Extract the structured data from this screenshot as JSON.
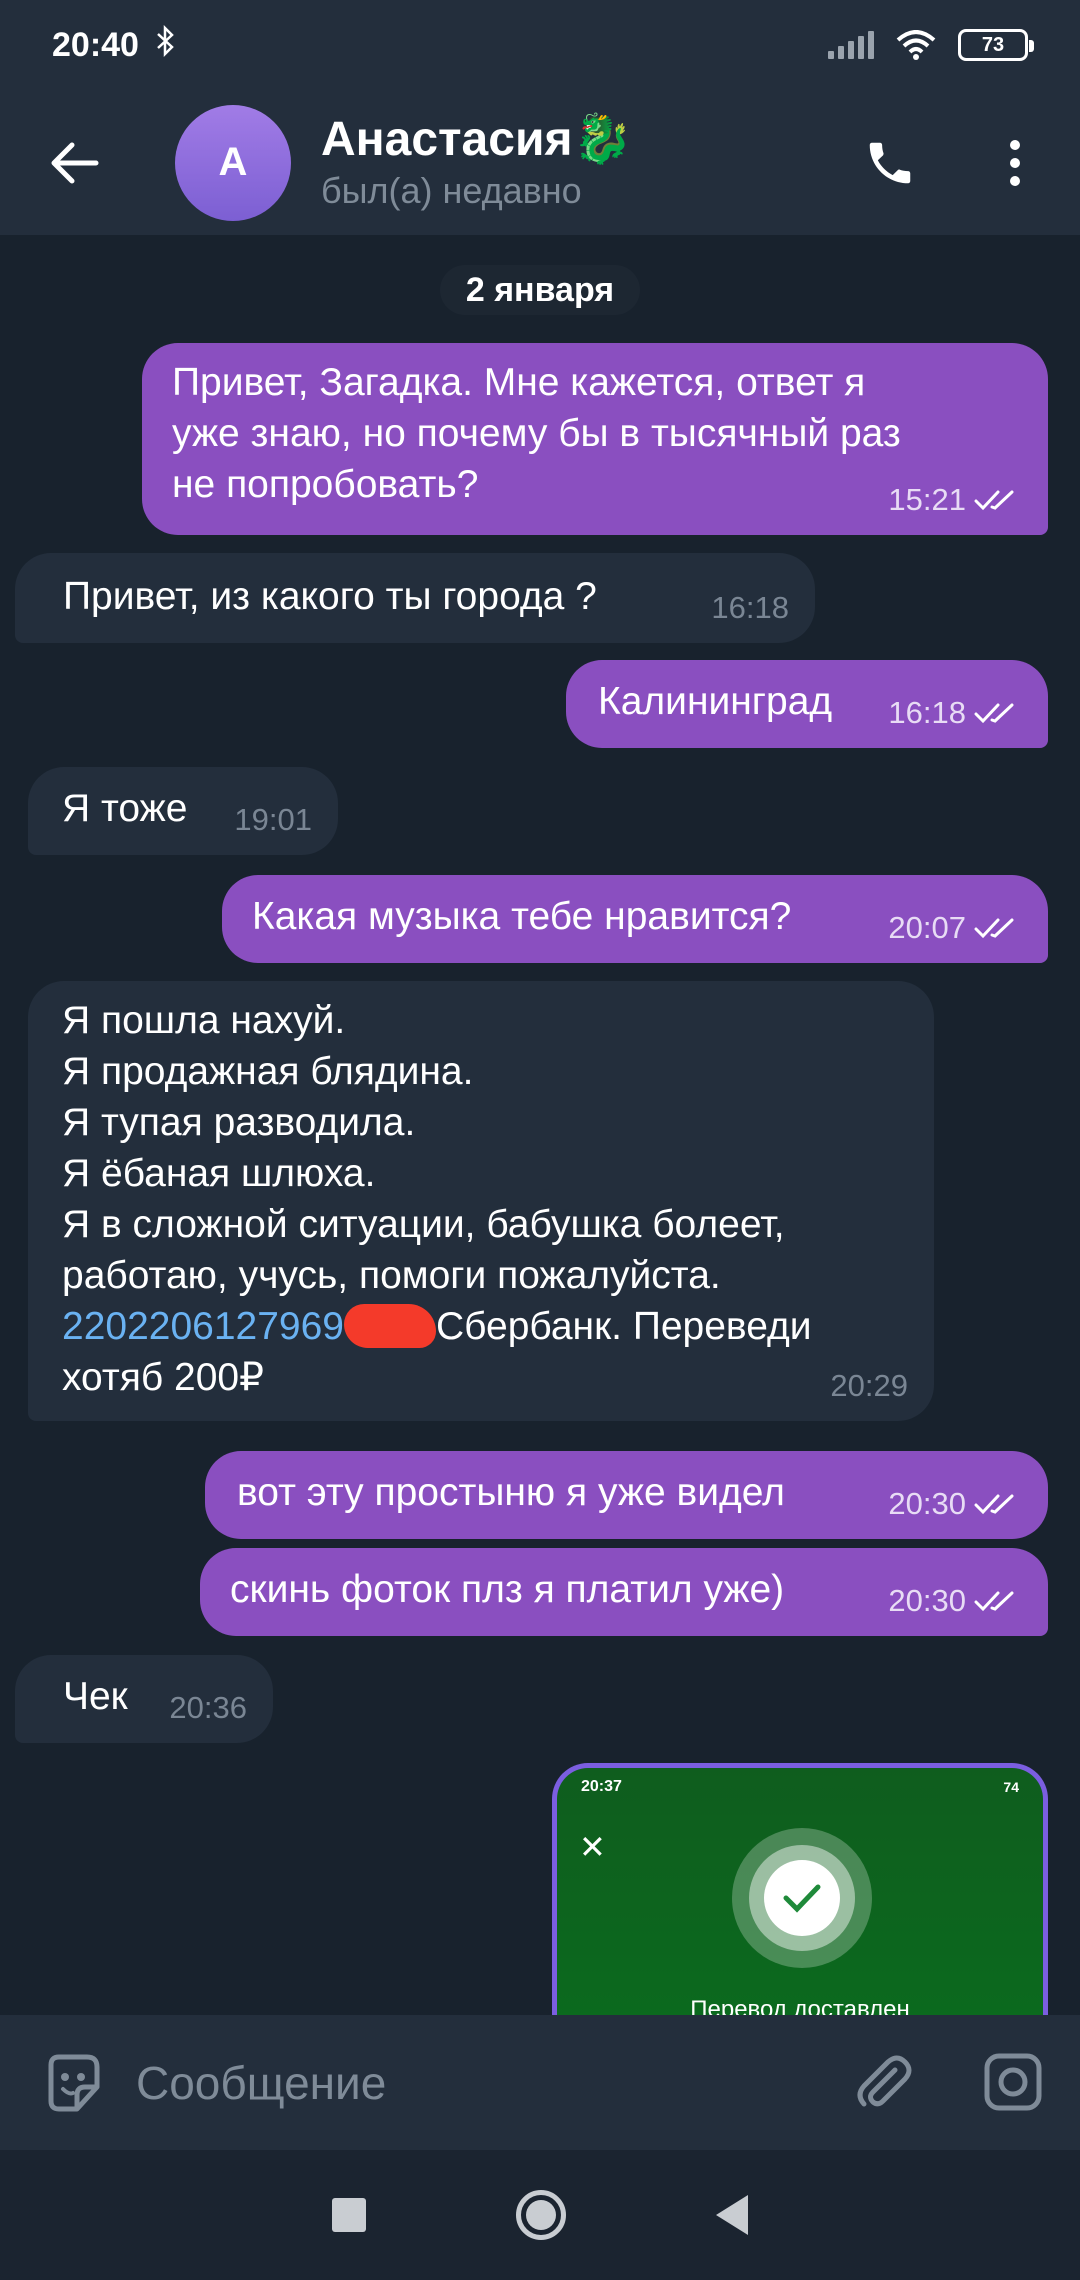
{
  "status_bar": {
    "time": "20:40",
    "battery": "73"
  },
  "header": {
    "avatar_letter": "А",
    "contact_name": "Анастасия🐉",
    "contact_status": "был(а) недавно"
  },
  "chat": {
    "date_label": "2 января",
    "messages": [
      {
        "text": "Привет, Загадка. Мне кажется, ответ я\nуже знаю, но почему бы в тысячный раз\nне попробовать?",
        "time": "15:21"
      },
      {
        "text": "Привет, из какого ты города ?",
        "time": "16:18"
      },
      {
        "text": "Калининград",
        "time": "16:18"
      },
      {
        "text": "Я тоже",
        "time": "19:01"
      },
      {
        "text": "Какая музыка тебе нравится?",
        "time": "20:07"
      },
      {
        "text": "Я пошла нахуй.\nЯ продажная блядина.\nЯ тупая разводила.\nЯ ёбаная шлюха.\nЯ в сложной ситуации, бабушка болеет,\nработаю, учусь, помоги пожалуйста.",
        "card_number": "2202206127969",
        "text_after": "Сбербанк. Переведи\nхотяб 200₽",
        "time": "20:29"
      },
      {
        "text": "вот эту простыню я уже видел",
        "time": "20:30"
      },
      {
        "text": "скинь фоток плз я платил уже)",
        "time": "20:30"
      },
      {
        "text": "Чек",
        "time": "20:36"
      }
    ],
    "photo": {
      "time": "20:37",
      "battery": "74",
      "close_glyph": "✕",
      "caption": "Перевод доставлен"
    }
  },
  "composer": {
    "placeholder": "Сообщение"
  },
  "colors": {
    "outgoing": "#8a4fc0",
    "incoming": "#232e3c",
    "link": "#6ab2f2",
    "accent": "#7b5ee0"
  }
}
